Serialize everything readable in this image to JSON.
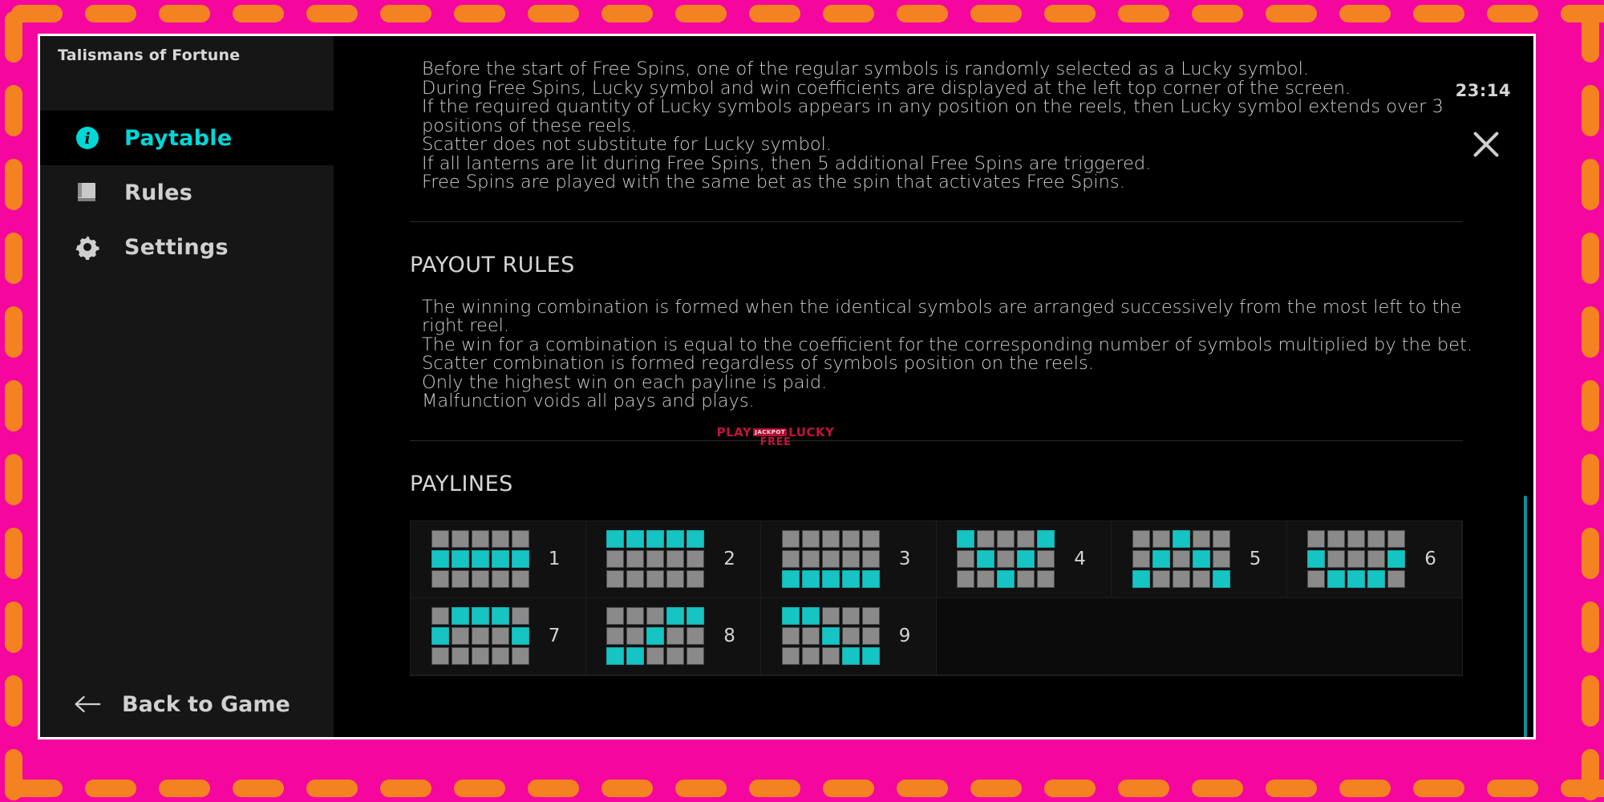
{
  "frame": {
    "bg_color": "#f5069f",
    "dash_color": "#f58220"
  },
  "window": {
    "title": "Talismans of Fortune",
    "clock": "23:14",
    "close_icon": "close-icon"
  },
  "sidebar": {
    "items": [
      {
        "label": "Paytable",
        "icon": "info-icon",
        "active": true
      },
      {
        "label": "Rules",
        "icon": "book-icon",
        "active": false
      },
      {
        "label": "Settings",
        "icon": "gear-icon",
        "active": false
      }
    ],
    "back": {
      "label": "Back to Game",
      "icon": "arrow-left-icon"
    }
  },
  "main": {
    "free_spins_rules": [
      "Before the start of Free Spins, one of the regular symbols is randomly selected as a Lucky symbol.",
      "During Free Spins, Lucky symbol and win coefficients are displayed at the left top corner of the screen.",
      "If the required quantity of Lucky symbols appears in any position on the reels, then Lucky symbol extends over 3 positions of these reels.",
      "Scatter does not substitute for Lucky symbol.",
      "If all lanterns are lit during Free Spins, then 5 additional Free Spins are triggered.",
      "Free Spins are played with the same bet as the spin that activates Free Spins."
    ],
    "payout_rules_title": "PAYOUT RULES",
    "payout_rules": [
      "The winning combination is formed when the identical symbols are arranged successively from the most left to the right reel.",
      "The win for a combination is equal to the coefficient for the corresponding number of symbols multiplied by the bet.",
      "Scatter combination is formed regardless of symbols position on the reels.",
      "Only the highest win on each payline is paid.",
      "Malfunction voids all pays and plays."
    ],
    "paylines_title": "PAYLINES",
    "paylines": [
      {
        "number": "1",
        "rows": [
          1,
          1,
          1,
          1,
          1
        ]
      },
      {
        "number": "2",
        "rows": [
          0,
          0,
          0,
          0,
          0
        ]
      },
      {
        "number": "3",
        "rows": [
          2,
          2,
          2,
          2,
          2
        ]
      },
      {
        "number": "4",
        "rows": [
          0,
          1,
          2,
          1,
          0
        ]
      },
      {
        "number": "5",
        "rows": [
          2,
          1,
          0,
          1,
          2
        ]
      },
      {
        "number": "6",
        "rows": [
          1,
          2,
          2,
          2,
          1
        ]
      },
      {
        "number": "7",
        "rows": [
          1,
          0,
          0,
          0,
          1
        ]
      },
      {
        "number": "8",
        "rows": [
          2,
          2,
          1,
          0,
          0
        ]
      },
      {
        "number": "9",
        "rows": [
          0,
          0,
          1,
          2,
          2
        ]
      }
    ]
  },
  "watermark": {
    "line1_left": "PLAY",
    "line1_badge": "JACKPOT",
    "line1_right": "LUCKY",
    "line2": "FREE"
  },
  "colors": {
    "accent_cyan": "#00d8d8",
    "payline_on": "#16c4c4",
    "payline_off": "#8a8a8a",
    "scrollbar": "#0e8e9e"
  }
}
